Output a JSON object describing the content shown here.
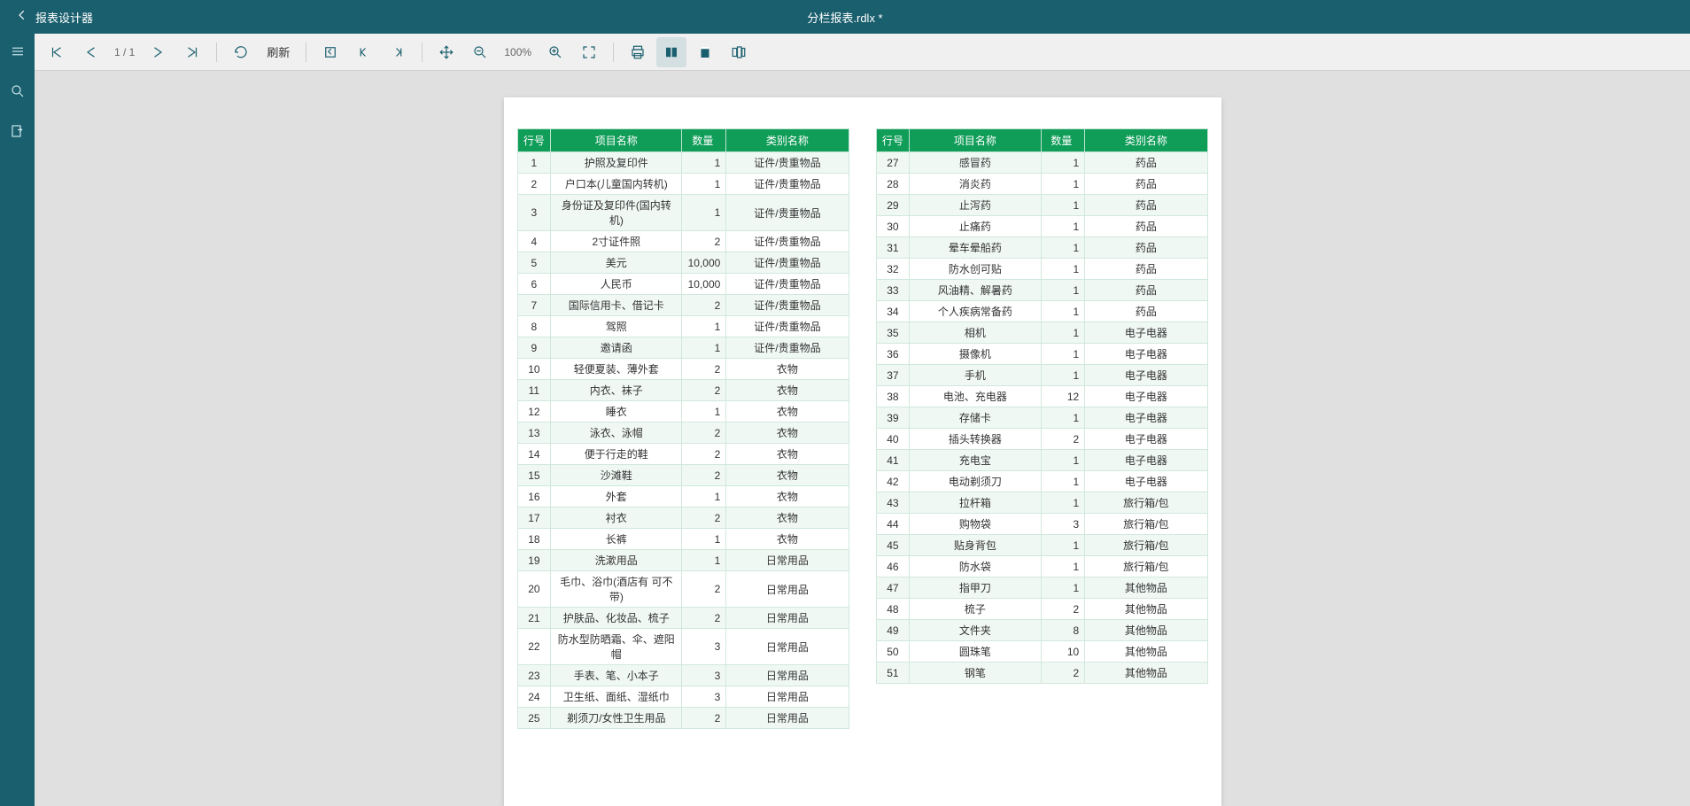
{
  "header": {
    "app_title": "报表设计器",
    "document_name": "分栏报表.rdlx *"
  },
  "toolbar": {
    "page_indicator": "1 / 1",
    "refresh_label": "刷新",
    "zoom_label": "100%"
  },
  "report": {
    "columns": {
      "row_no": "行号",
      "item_name": "项目名称",
      "qty": "数量",
      "category": "类别名称"
    },
    "left_rows": [
      {
        "n": "1",
        "name": "护照及复印件",
        "q": "1",
        "c": "证件/贵重物品"
      },
      {
        "n": "2",
        "name": "户口本(儿童国内转机)",
        "q": "1",
        "c": "证件/贵重物品"
      },
      {
        "n": "3",
        "name": "身份证及复印件(国内转机)",
        "q": "1",
        "c": "证件/贵重物品"
      },
      {
        "n": "4",
        "name": "2寸证件照",
        "q": "2",
        "c": "证件/贵重物品"
      },
      {
        "n": "5",
        "name": "美元",
        "q": "10,000",
        "c": "证件/贵重物品"
      },
      {
        "n": "6",
        "name": "人民币",
        "q": "10,000",
        "c": "证件/贵重物品"
      },
      {
        "n": "7",
        "name": "国际信用卡、借记卡",
        "q": "2",
        "c": "证件/贵重物品"
      },
      {
        "n": "8",
        "name": "驾照",
        "q": "1",
        "c": "证件/贵重物品"
      },
      {
        "n": "9",
        "name": "邀请函",
        "q": "1",
        "c": "证件/贵重物品"
      },
      {
        "n": "10",
        "name": "轻便夏装、薄外套",
        "q": "2",
        "c": "衣物"
      },
      {
        "n": "11",
        "name": "内衣、袜子",
        "q": "2",
        "c": "衣物"
      },
      {
        "n": "12",
        "name": "睡衣",
        "q": "1",
        "c": "衣物"
      },
      {
        "n": "13",
        "name": "泳衣、泳帽",
        "q": "2",
        "c": "衣物"
      },
      {
        "n": "14",
        "name": "便于行走的鞋",
        "q": "2",
        "c": "衣物"
      },
      {
        "n": "15",
        "name": "沙滩鞋",
        "q": "2",
        "c": "衣物"
      },
      {
        "n": "16",
        "name": "外套",
        "q": "1",
        "c": "衣物"
      },
      {
        "n": "17",
        "name": "衬衣",
        "q": "2",
        "c": "衣物"
      },
      {
        "n": "18",
        "name": "长裤",
        "q": "1",
        "c": "衣物"
      },
      {
        "n": "19",
        "name": "洗漱用品",
        "q": "1",
        "c": "日常用品"
      },
      {
        "n": "20",
        "name": "毛巾、浴巾(酒店有 可不带)",
        "q": "2",
        "c": "日常用品"
      },
      {
        "n": "21",
        "name": "护肤品、化妆品、梳子",
        "q": "2",
        "c": "日常用品"
      },
      {
        "n": "22",
        "name": "防水型防晒霜、伞、遮阳帽",
        "q": "3",
        "c": "日常用品"
      },
      {
        "n": "23",
        "name": "手表、笔、小本子",
        "q": "3",
        "c": "日常用品"
      },
      {
        "n": "24",
        "name": "卫生纸、面纸、湿纸巾",
        "q": "3",
        "c": "日常用品"
      },
      {
        "n": "25",
        "name": "剃须刀/女性卫生用品",
        "q": "2",
        "c": "日常用品"
      }
    ],
    "right_rows": [
      {
        "n": "27",
        "name": "感冒药",
        "q": "1",
        "c": "药品"
      },
      {
        "n": "28",
        "name": "消炎药",
        "q": "1",
        "c": "药品"
      },
      {
        "n": "29",
        "name": "止泻药",
        "q": "1",
        "c": "药品"
      },
      {
        "n": "30",
        "name": "止痛药",
        "q": "1",
        "c": "药品"
      },
      {
        "n": "31",
        "name": "晕车晕船药",
        "q": "1",
        "c": "药品"
      },
      {
        "n": "32",
        "name": "防水创可贴",
        "q": "1",
        "c": "药品"
      },
      {
        "n": "33",
        "name": "风油精、解暑药",
        "q": "1",
        "c": "药品"
      },
      {
        "n": "34",
        "name": "个人疾病常备药",
        "q": "1",
        "c": "药品"
      },
      {
        "n": "35",
        "name": "相机",
        "q": "1",
        "c": "电子电器"
      },
      {
        "n": "36",
        "name": "摄像机",
        "q": "1",
        "c": "电子电器"
      },
      {
        "n": "37",
        "name": "手机",
        "q": "1",
        "c": "电子电器"
      },
      {
        "n": "38",
        "name": "电池、充电器",
        "q": "12",
        "c": "电子电器"
      },
      {
        "n": "39",
        "name": "存储卡",
        "q": "1",
        "c": "电子电器"
      },
      {
        "n": "40",
        "name": "插头转换器",
        "q": "2",
        "c": "电子电器"
      },
      {
        "n": "41",
        "name": "充电宝",
        "q": "1",
        "c": "电子电器"
      },
      {
        "n": "42",
        "name": "电动剃须刀",
        "q": "1",
        "c": "电子电器"
      },
      {
        "n": "43",
        "name": "拉杆箱",
        "q": "1",
        "c": "旅行箱/包"
      },
      {
        "n": "44",
        "name": "购物袋",
        "q": "3",
        "c": "旅行箱/包"
      },
      {
        "n": "45",
        "name": "贴身背包",
        "q": "1",
        "c": "旅行箱/包"
      },
      {
        "n": "46",
        "name": "防水袋",
        "q": "1",
        "c": "旅行箱/包"
      },
      {
        "n": "47",
        "name": "指甲刀",
        "q": "1",
        "c": "其他物品"
      },
      {
        "n": "48",
        "name": "梳子",
        "q": "2",
        "c": "其他物品"
      },
      {
        "n": "49",
        "name": "文件夹",
        "q": "8",
        "c": "其他物品"
      },
      {
        "n": "50",
        "name": "圆珠笔",
        "q": "10",
        "c": "其他物品"
      },
      {
        "n": "51",
        "name": "钢笔",
        "q": "2",
        "c": "其他物品"
      }
    ]
  }
}
